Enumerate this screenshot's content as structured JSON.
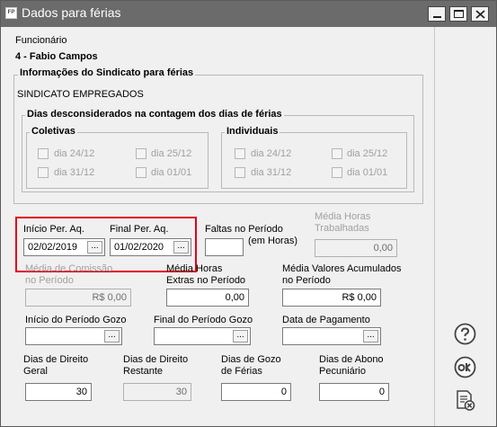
{
  "window": {
    "title": "Dados para férias",
    "app_icon": "FP"
  },
  "employee": {
    "label": "Funcionário",
    "value": "4 - Fabio Campos"
  },
  "union": {
    "group_title": "Informações do Sindicato para férias",
    "name": "SINDICATO EMPREGADOS",
    "days_group_title": "Dias desconsiderados na contagem dos dias de férias",
    "coletivas": {
      "title": "Coletivas",
      "days": [
        "dia 24/12",
        "dia 25/12",
        "dia 31/12",
        "dia 01/01"
      ]
    },
    "individuais": {
      "title": "Individuais",
      "days": [
        "dia 24/12",
        "dia 25/12",
        "dia 31/12",
        "dia 01/01"
      ]
    }
  },
  "period": {
    "inicio_label": "Início Per. Aq.",
    "inicio_value": "02/02/2019",
    "final_label": "Final Per. Aq.",
    "final_value": "01/02/2020",
    "faltas_label": "Faltas no Período",
    "faltas_unit": "(em Horas)",
    "faltas_value": "",
    "media_horas_label_1": "Média Horas",
    "media_horas_label_2": "Trabalhadas",
    "media_horas_value": "0,00"
  },
  "averages": {
    "comissao_label_1": "Média de Comissão",
    "comissao_label_2": "no Período",
    "comissao_value": "R$ 0,00",
    "extras_label_1": "Média Horas",
    "extras_label_2": "Extras no Período",
    "extras_value": "0,00",
    "valores_label_1": "Média Valores Acumulados",
    "valores_label_2": "no Período",
    "valores_value": "R$ 0,00"
  },
  "gozo": {
    "inicio_label": "Início do Período Gozo",
    "inicio_value": "",
    "final_label": "Final do Período Gozo",
    "final_value": "",
    "pagamento_label": "Data de Pagamento",
    "pagamento_value": ""
  },
  "days": {
    "direito_geral_label_1": "Dias de Direito",
    "direito_geral_label_2": "Geral",
    "direito_geral_value": "30",
    "direito_restante_label_1": "Dias de Direito",
    "direito_restante_label_2": "Restante",
    "direito_restante_value": "30",
    "gozo_label_1": "Dias de Gozo",
    "gozo_label_2": "de Férias",
    "gozo_value": "0",
    "abono_label_1": "Dias de Abono",
    "abono_label_2": "Pecuniário",
    "abono_value": "0"
  },
  "ellipsis": "..."
}
